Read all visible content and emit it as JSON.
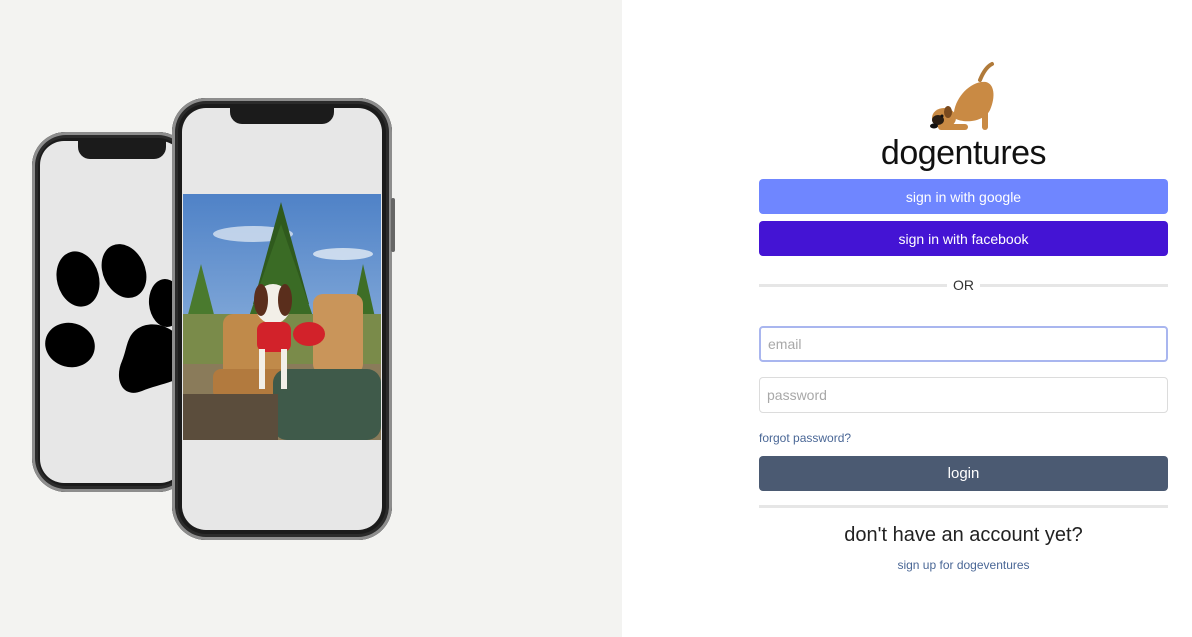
{
  "brand": {
    "name": "dogentures"
  },
  "auth": {
    "google_label": "sign in with google",
    "facebook_label": "sign in with facebook",
    "divider_label": "OR",
    "email_placeholder": "email",
    "password_placeholder": "password",
    "forgot_label": "forgot password?",
    "login_label": "login",
    "signup_prompt": "don't have an account yet?",
    "signup_link": "sign up for dogeventures"
  },
  "colors": {
    "google_button": "#6f86ff",
    "facebook_button": "#4414d4",
    "login_button": "#4b5a72",
    "link": "#4a6796",
    "left_panel_bg": "#f3f3f1"
  },
  "icons": {
    "logo": "dog-stretching-icon",
    "paw": "paw-print-icon"
  }
}
